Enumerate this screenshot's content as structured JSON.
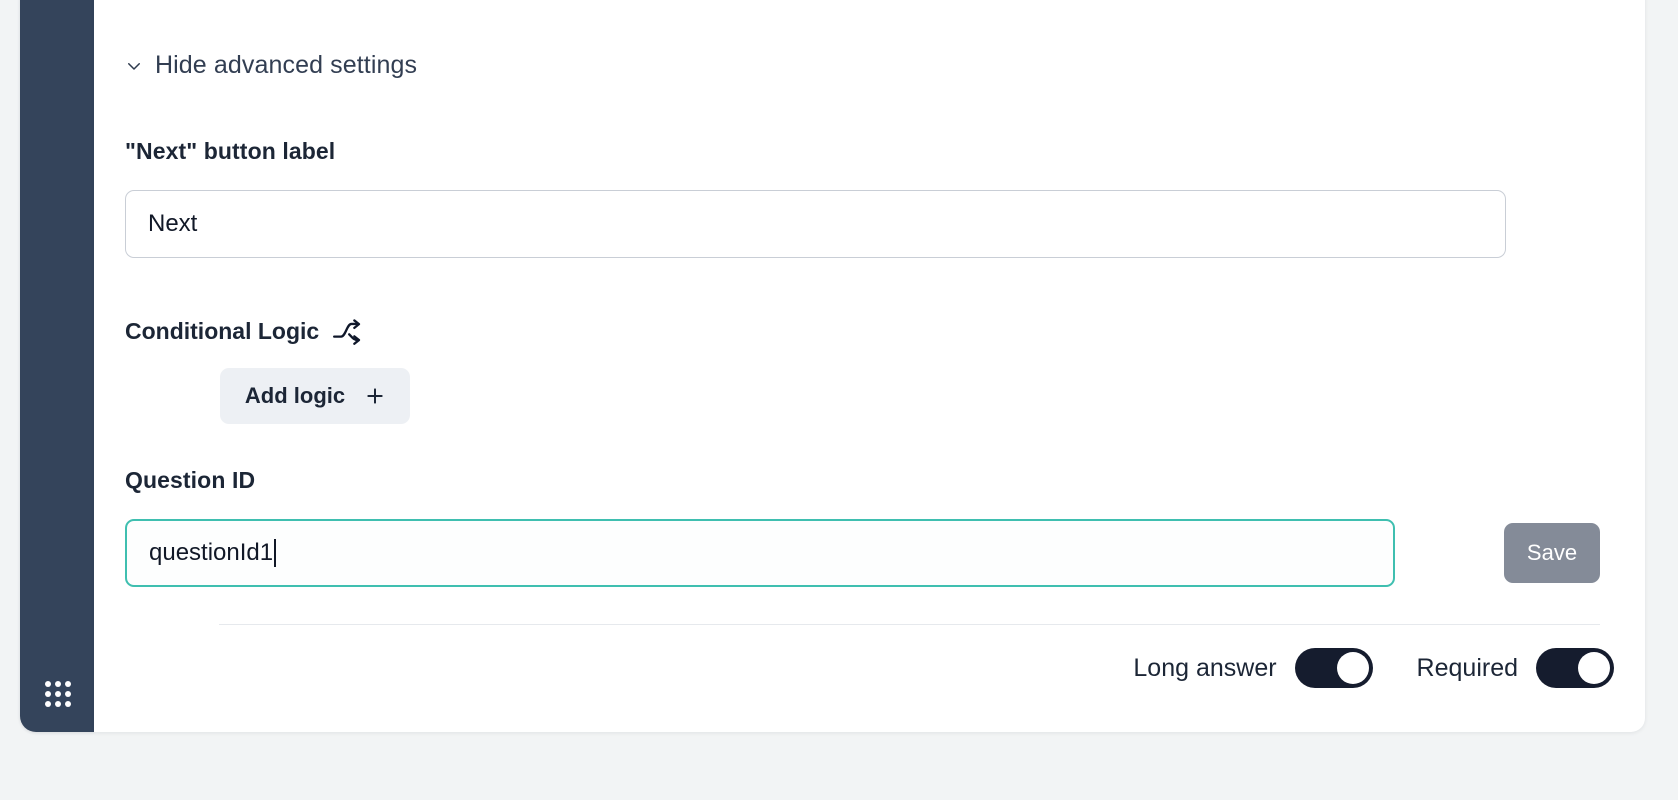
{
  "sidebar": {
    "grip_icon": "grid-dots-icon"
  },
  "advanced": {
    "toggle_label": "Hide advanced settings",
    "chevron_icon": "chevron-down-icon"
  },
  "next_button_label": {
    "label": "\"Next\" button label",
    "value": "Next",
    "placeholder": "Next"
  },
  "conditional_logic": {
    "label": "Conditional Logic",
    "icon": "split-arrows-icon",
    "add_logic_label": "Add logic",
    "add_logic_icon": "plus-icon"
  },
  "question_id": {
    "label": "Question ID",
    "value": "questionId1",
    "placeholder": "questionId1",
    "save_label": "Save"
  },
  "footer": {
    "long_answer_label": "Long answer",
    "long_answer_on": true,
    "required_label": "Required",
    "required_on": true
  },
  "colors": {
    "sidebar": "#34445b",
    "focus_border": "#3fbfb0",
    "toggle_on": "#151c2e",
    "save_button": "#848b98",
    "add_logic_bg": "#edf0f4",
    "text": "#1c2636"
  }
}
